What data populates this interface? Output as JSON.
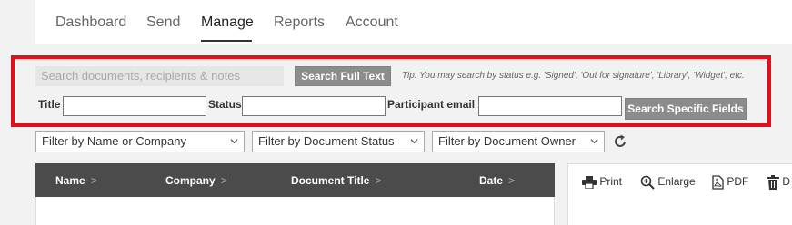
{
  "nav": {
    "tabs": [
      {
        "label": "Dashboard"
      },
      {
        "label": "Send"
      },
      {
        "label": "Manage"
      },
      {
        "label": "Reports"
      },
      {
        "label": "Account"
      }
    ],
    "active_tab": "Manage"
  },
  "search": {
    "full_text_placeholder": "Search documents, recipients & notes",
    "full_text_button": "Search Full Text",
    "tip": "Tip: You may search by status e.g. 'Signed', 'Out for signature', 'Library', 'Widget', etc.",
    "title_label": "Title",
    "status_label": "Status",
    "participant_label": "Participant email",
    "specific_button": "Search Specific Fields",
    "highlight_color": "#e0111d"
  },
  "filters": [
    {
      "label": "Filter by Name or Company"
    },
    {
      "label": "Filter by Document Status"
    },
    {
      "label": "Filter by Document Owner"
    }
  ],
  "table": {
    "columns": [
      {
        "label": "Name"
      },
      {
        "label": "Company"
      },
      {
        "label": "Document Title"
      },
      {
        "label": "Date"
      }
    ],
    "arrow": ">"
  },
  "preview": {
    "actions": [
      {
        "label": "Print",
        "icon": "printer-icon"
      },
      {
        "label": "Enlarge",
        "icon": "zoom-in-icon"
      },
      {
        "label": "PDF",
        "icon": "pdf-icon"
      },
      {
        "label": "D",
        "icon": "trash-icon"
      }
    ]
  }
}
